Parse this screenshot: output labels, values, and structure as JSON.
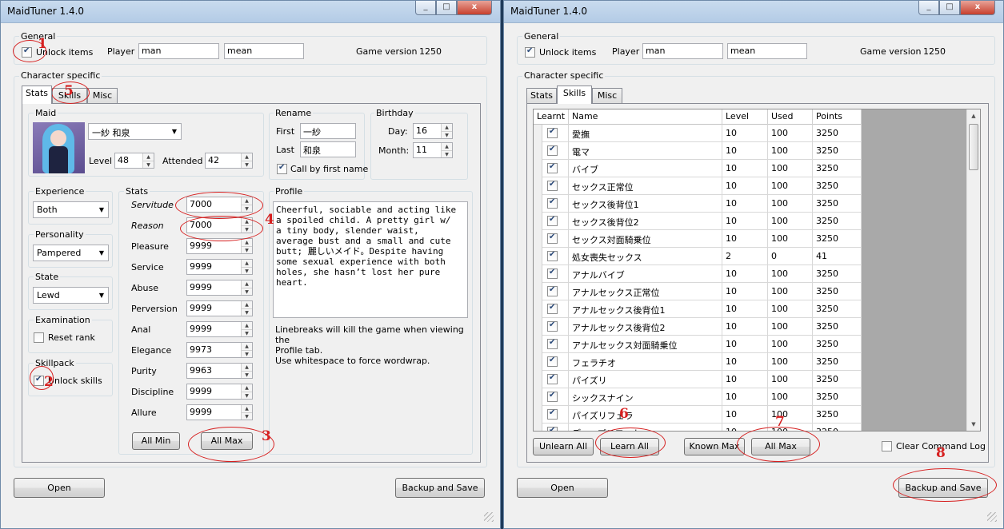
{
  "windows": [
    {
      "title": "MaidTuner 1.4.0",
      "general": {
        "label": "General",
        "unlock_items": "Unlock items",
        "player_label": "Player",
        "player_first": "man",
        "player_last": "mean",
        "game_version_label": "Game version",
        "game_version": "1250"
      },
      "character_label": "Character specific",
      "tabs": [
        "Stats",
        "Skills",
        "Misc"
      ],
      "maid": {
        "label": "Maid",
        "name": "一紗 和泉",
        "level_label": "Level",
        "level": "48",
        "attended_label": "Attended",
        "attended": "42"
      },
      "rename": {
        "label": "Rename",
        "first_label": "First",
        "first": "一紗",
        "last_label": "Last",
        "last": "和泉",
        "call_first": "Call by first name"
      },
      "birthday": {
        "label": "Birthday",
        "day_label": "Day:",
        "day": "16",
        "month_label": "Month:",
        "month": "11"
      },
      "experience": {
        "label": "Experience",
        "value": "Both"
      },
      "personality": {
        "label": "Personality",
        "value": "Pampered"
      },
      "state": {
        "label": "State",
        "value": "Lewd"
      },
      "examination": {
        "label": "Examination",
        "reset_rank": "Reset rank"
      },
      "skillpack": {
        "label": "Skillpack",
        "unlock_skills": "Unlock skills"
      },
      "stats": {
        "label": "Stats",
        "items": [
          {
            "name": "Servitude",
            "value": "7000"
          },
          {
            "name": "Reason",
            "value": "7000"
          },
          {
            "name": "Pleasure",
            "value": "9999"
          },
          {
            "name": "Service",
            "value": "9999"
          },
          {
            "name": "Abuse",
            "value": "9999"
          },
          {
            "name": "Perversion",
            "value": "9999"
          },
          {
            "name": "Anal",
            "value": "9999"
          },
          {
            "name": "Elegance",
            "value": "9973"
          },
          {
            "name": "Purity",
            "value": "9963"
          },
          {
            "name": "Discipline",
            "value": "9999"
          },
          {
            "name": "Allure",
            "value": "9999"
          }
        ],
        "all_min": "All Min",
        "all_max": "All Max"
      },
      "profile": {
        "label": "Profile",
        "text": "Cheerful, sociable and acting like\na spoiled child. A pretty girl w/\na tiny body, slender waist,\naverage bust and a small and cute\nbutt; 麗しいメイド。Despite having\nsome sexual experience with both\nholes, she hasn’t lost her pure\nheart.",
        "note": "Linebreaks will kill the game when viewing the\nProfile tab.\nUse whitespace to force wordwrap."
      },
      "open": "Open",
      "backup_save": "Backup and Save",
      "annotations": [
        "1",
        "5",
        "4",
        "2",
        "3"
      ]
    },
    {
      "title": "MaidTuner 1.4.0",
      "general": {
        "label": "General",
        "unlock_items": "Unlock items",
        "player_label": "Player",
        "player_first": "man",
        "player_last": "mean",
        "game_version_label": "Game version",
        "game_version": "1250"
      },
      "character_label": "Character specific",
      "tabs": [
        "Stats",
        "Skills",
        "Misc"
      ],
      "skills": {
        "headers": [
          "Learnt",
          "Name",
          "Level",
          "Used",
          "Points"
        ],
        "rows": [
          {
            "name": "愛撫",
            "level": "10",
            "used": "100",
            "points": "3250"
          },
          {
            "name": "電マ",
            "level": "10",
            "used": "100",
            "points": "3250"
          },
          {
            "name": "バイブ",
            "level": "10",
            "used": "100",
            "points": "3250"
          },
          {
            "name": "セックス正常位",
            "level": "10",
            "used": "100",
            "points": "3250"
          },
          {
            "name": "セックス後背位1",
            "level": "10",
            "used": "100",
            "points": "3250"
          },
          {
            "name": "セックス後背位2",
            "level": "10",
            "used": "100",
            "points": "3250"
          },
          {
            "name": "セックス対面騎乗位",
            "level": "10",
            "used": "100",
            "points": "3250"
          },
          {
            "name": "処女喪失セックス",
            "level": "2",
            "used": "0",
            "points": "41"
          },
          {
            "name": "アナルバイブ",
            "level": "10",
            "used": "100",
            "points": "3250"
          },
          {
            "name": "アナルセックス正常位",
            "level": "10",
            "used": "100",
            "points": "3250"
          },
          {
            "name": "アナルセックス後背位1",
            "level": "10",
            "used": "100",
            "points": "3250"
          },
          {
            "name": "アナルセックス後背位2",
            "level": "10",
            "used": "100",
            "points": "3250"
          },
          {
            "name": "アナルセックス対面騎乗位",
            "level": "10",
            "used": "100",
            "points": "3250"
          },
          {
            "name": "フェラチオ",
            "level": "10",
            "used": "100",
            "points": "3250"
          },
          {
            "name": "パイズリ",
            "level": "10",
            "used": "100",
            "points": "3250"
          },
          {
            "name": "シックスナイン",
            "level": "10",
            "used": "100",
            "points": "3250"
          },
          {
            "name": "パイズリフェラ",
            "level": "10",
            "used": "100",
            "points": "3250"
          },
          {
            "name": "ディープスロート",
            "level": "10",
            "used": "100",
            "points": "3250"
          }
        ],
        "unlearn_all": "Unlearn All",
        "learn_all": "Learn All",
        "known_max": "Known Max",
        "all_max": "All Max",
        "clear_log": "Clear Command Log"
      },
      "open": "Open",
      "backup_save": "Backup and Save",
      "annotations": [
        "6",
        "7",
        "8"
      ]
    }
  ],
  "titlebar_buttons": {
    "close": "x"
  },
  "colors": {
    "annotation": "#d62020",
    "titlebar": "#b9cfe8",
    "window_bg": "#f0f0f0"
  }
}
